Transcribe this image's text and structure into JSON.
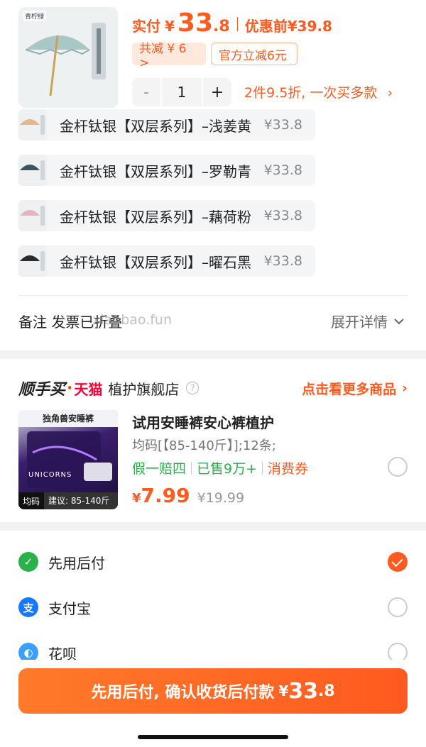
{
  "summary": {
    "thumb_tag": "青柠绿",
    "paid_label": "实付",
    "paid_currency": "¥",
    "paid_int": "33",
    "paid_dec": ".8",
    "before_label": "优惠前",
    "before_price": "¥39.8",
    "discount_coupon": "共减 ¥ 6 >",
    "official_coupon": "官方立减6元",
    "qty_minus": "-",
    "qty_value": "1",
    "qty_plus": "+",
    "multi_offer": "2件9.5折, 一次买多款"
  },
  "variants": [
    {
      "name": "金杆钛银【双层系列】–浅姜黄",
      "price": "¥33.8",
      "color": "#e2b98a"
    },
    {
      "name": "金杆钛银【双层系列】–罗勒青",
      "price": "¥33.8",
      "color": "#3d5560"
    },
    {
      "name": "金杆钛银【双层系列】–藕荷粉",
      "price": "¥33.8",
      "color": "#e3b6bd"
    },
    {
      "name": "金杆钛银【双层系列】–曜石黑",
      "price": "¥33.8",
      "color": "#2b2b2b"
    }
  ],
  "remark": {
    "label": "备注 发票已折叠",
    "expand": "展开详情",
    "watermark": "xianbao.fun"
  },
  "shop": {
    "brand_a": "顺手买",
    "brand_dot": "·",
    "brand_b": "天猫",
    "name": "植护旗舰店",
    "help": "?",
    "more": "点击看更多商品"
  },
  "recommend": {
    "img_title": "独角兽安睡裤",
    "img_brand": "UNICORNS",
    "img_tag_a": "均码",
    "img_tag_b": "建议: 85-140斤",
    "name": "试用安睡裤安心裤植护",
    "spec": "均码[【85-140斤】];12条;",
    "tag1": "假一赔四",
    "tag2": "已售9万+",
    "tag3": "消费券",
    "currency": "¥",
    "price": "7.99",
    "orig_price": "¥19.99"
  },
  "payments": [
    {
      "label": "先用后付",
      "icon": "pay-later-icon",
      "color": "#2ab14b",
      "glyph": "✓",
      "checked": true
    },
    {
      "label": "支付宝",
      "icon": "alipay-icon",
      "color": "#1677ff",
      "glyph": "支",
      "checked": false
    },
    {
      "label": "花呗",
      "icon": "huabei-icon",
      "color": "#3aa0ff",
      "glyph": "◐",
      "checked": false
    }
  ],
  "cta": {
    "text": "先用后付, 确认收货后付款",
    "currency": "¥",
    "amount_int": "33",
    "amount_dec": ".8"
  }
}
